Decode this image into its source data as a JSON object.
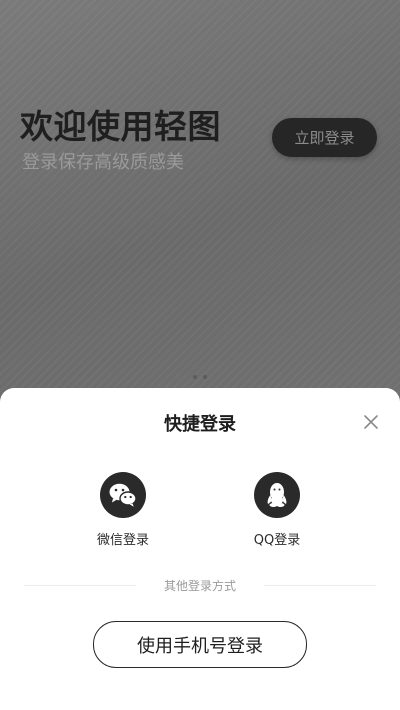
{
  "hero": {
    "title": "欢迎使用轻图",
    "subtitle": "登录保存高级质感美",
    "login_button": "立即登录"
  },
  "sheet": {
    "title": "快捷登录",
    "options": [
      {
        "label": "微信登录",
        "icon": "wechat-icon"
      },
      {
        "label": "QQ登录",
        "icon": "qq-icon"
      }
    ],
    "other_methods_text": "其他登录方式",
    "phone_button": "使用手机号登录"
  },
  "colors": {
    "background": "#6f6f6f",
    "sheet": "#ffffff",
    "dark": "#262626"
  }
}
